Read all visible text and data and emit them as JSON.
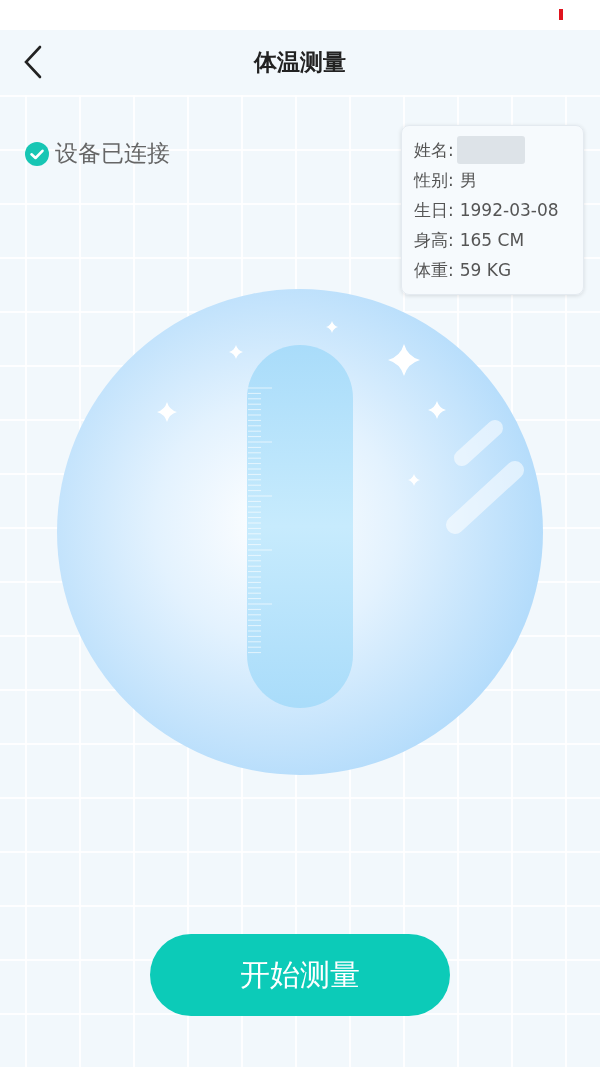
{
  "header": {
    "title": "体温测量"
  },
  "device": {
    "label": "设备已连接",
    "connected": true
  },
  "profile": {
    "rows": [
      {
        "label": "姓名:",
        "blurred": true
      },
      {
        "label": "性别:",
        "value": "男",
        "blurred": false
      },
      {
        "label": "生日:",
        "value": "1992-03-08",
        "blurred": false
      },
      {
        "label": "身高:",
        "value": "165 CM",
        "blurred": false
      },
      {
        "label": "体重:",
        "value": "59 KG",
        "blurred": false
      }
    ]
  },
  "action": {
    "label": "开始测量"
  }
}
